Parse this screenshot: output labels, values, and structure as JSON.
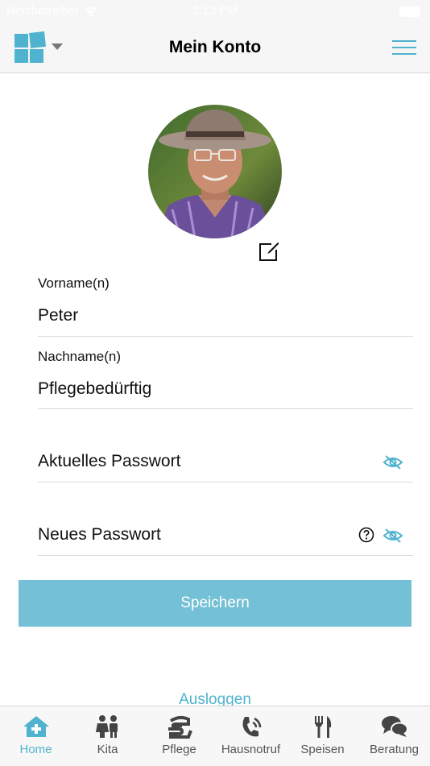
{
  "status_bar": {
    "carrier": "Netzbetreiber",
    "time": "3:13 PM"
  },
  "header": {
    "title": "Mein Konto"
  },
  "profile": {
    "first_name_label": "Vorname(n)",
    "first_name_value": "Peter",
    "last_name_label": "Nachname(n)",
    "last_name_value": "Pflegebedürftig",
    "current_password_placeholder": "Aktuelles Passwort",
    "new_password_placeholder": "Neues Passwort"
  },
  "actions": {
    "save_label": "Speichern",
    "logout_label": "Ausloggen"
  },
  "tabs": [
    {
      "label": "Home",
      "icon": "home-plus-icon",
      "active": true
    },
    {
      "label": "Kita",
      "icon": "children-icon",
      "active": false
    },
    {
      "label": "Pflege",
      "icon": "care-hand-icon",
      "active": false
    },
    {
      "label": "Hausnotruf",
      "icon": "phone-call-icon",
      "active": false
    },
    {
      "label": "Speisen",
      "icon": "cutlery-icon",
      "active": false
    },
    {
      "label": "Beratung",
      "icon": "chat-bubbles-icon",
      "active": false
    }
  ],
  "colors": {
    "accent": "#4fb2cf",
    "button": "#74c0d6",
    "tab_icon": "#444444"
  }
}
